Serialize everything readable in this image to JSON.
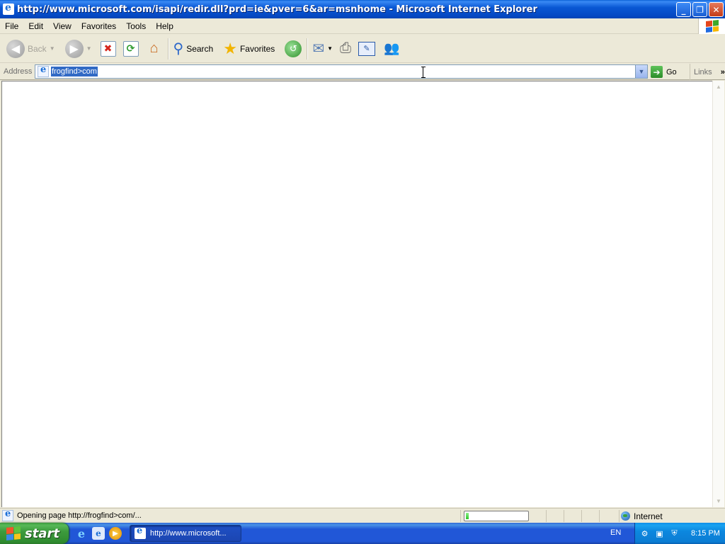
{
  "window": {
    "title": "http://www.microsoft.com/isapi/redir.dll?prd=ie&pver=6&ar=msnhome - Microsoft Internet Explorer",
    "buttons": {
      "minimize": "_",
      "restore": "❐",
      "close": "✕"
    }
  },
  "menu": {
    "items": [
      "File",
      "Edit",
      "View",
      "Favorites",
      "Tools",
      "Help"
    ]
  },
  "toolbar": {
    "back_label": "Back",
    "search_label": "Search",
    "favorites_label": "Favorites"
  },
  "address": {
    "label": "Address",
    "value": "frogfind>com",
    "go_label": "Go",
    "links_label": "Links"
  },
  "status": {
    "text": "Opening page http://frogfind>com/...",
    "progress": 0.05,
    "zone": "Internet"
  },
  "taskbar": {
    "start_label": "start",
    "task_label": "http://www.microsoft...",
    "language": "EN",
    "clock": "8:15 PM"
  },
  "colors": {
    "titlebar": "#0a58d4",
    "selection": "#316ac5",
    "taskbar": "#2157d7",
    "start": "#3d9b3d"
  }
}
